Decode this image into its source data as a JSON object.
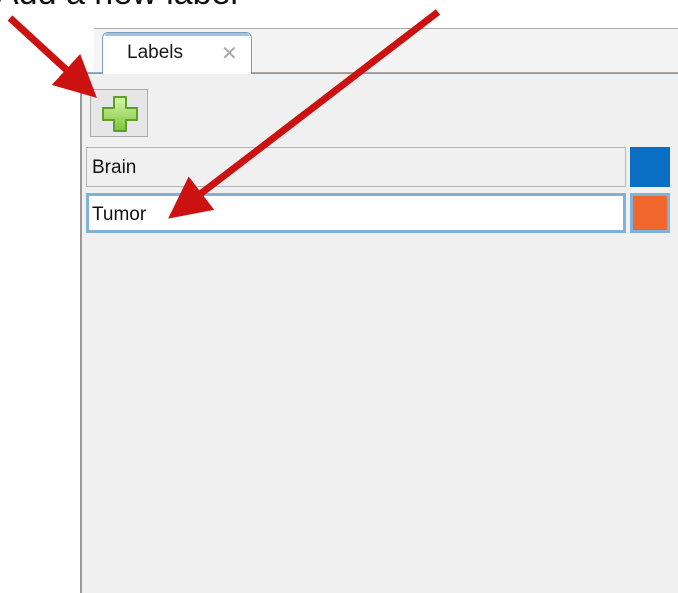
{
  "caption": "Add a new label",
  "tab": {
    "title": "Labels",
    "close_glyph": "✕"
  },
  "toolbar": {
    "add_icon": "green-plus-icon"
  },
  "labels": [
    {
      "name": "Brain",
      "color": "#0a6ec2"
    },
    {
      "name": "Tumor",
      "color": "#f0672e"
    }
  ],
  "annotation_color": "#cc1111"
}
